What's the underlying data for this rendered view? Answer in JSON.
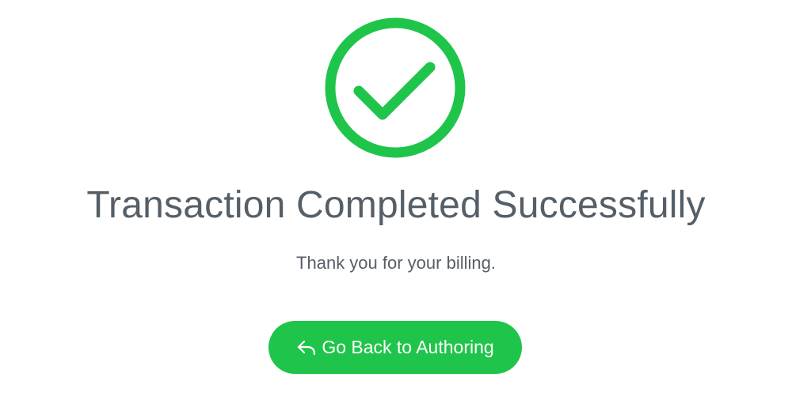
{
  "status": {
    "icon": "check-circle-icon",
    "title": "Transaction Completed Successfully",
    "message": "Thank you for your billing."
  },
  "actions": {
    "back_label": "Go Back to Authoring",
    "back_icon": "reply-arrow-icon"
  },
  "colors": {
    "accent": "#1fc54a",
    "text": "#555f68",
    "background": "#ffffff"
  }
}
